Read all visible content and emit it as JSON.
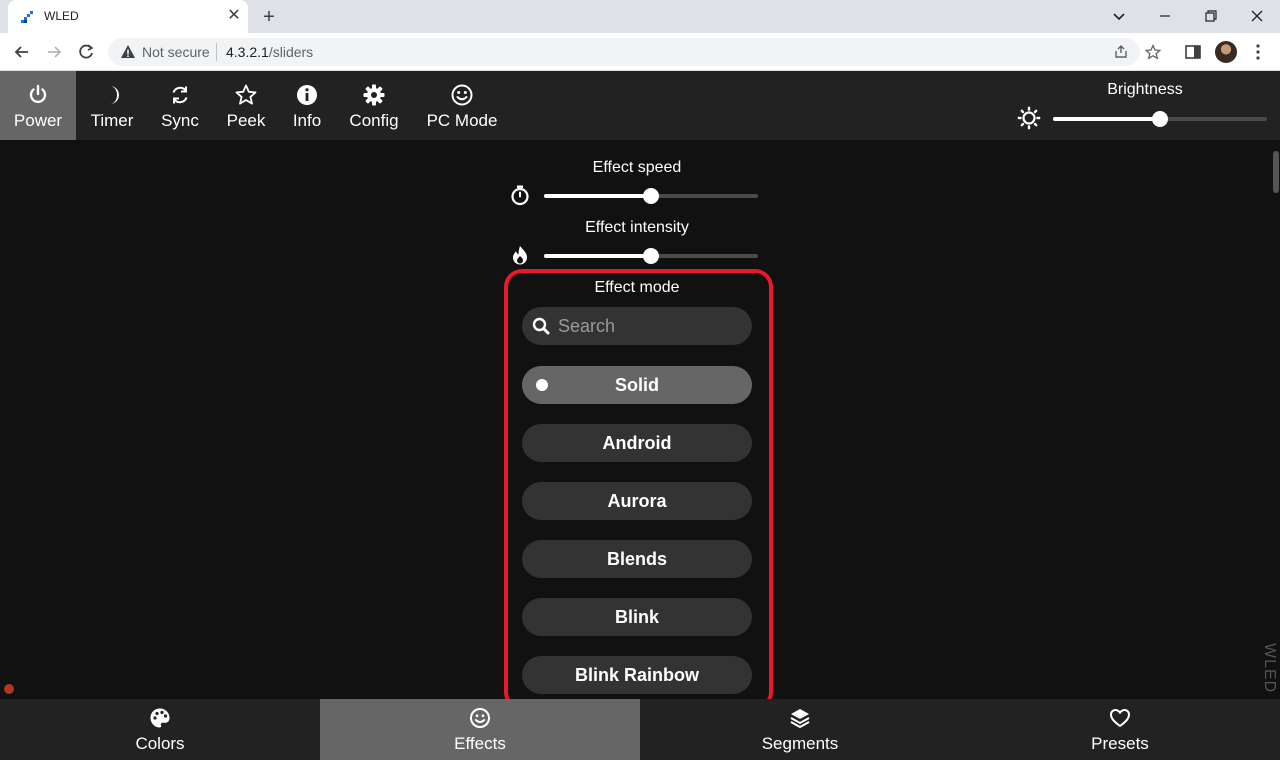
{
  "browser": {
    "tab_title": "WLED",
    "not_secure": "Not secure",
    "url_host": "4.3.2.1",
    "url_path": "/sliders"
  },
  "topbar": {
    "buttons": [
      {
        "label": "Power",
        "icon": "power-icon"
      },
      {
        "label": "Timer",
        "icon": "moon-icon"
      },
      {
        "label": "Sync",
        "icon": "sync-icon"
      },
      {
        "label": "Peek",
        "icon": "star-icon"
      },
      {
        "label": "Info",
        "icon": "info-icon"
      },
      {
        "label": "Config",
        "icon": "gear-icon"
      },
      {
        "label": "PC Mode",
        "icon": "smiley-icon"
      }
    ],
    "active": "Power",
    "brightness_label": "Brightness",
    "brightness_value": 0.5
  },
  "effects": {
    "speed_label": "Effect speed",
    "speed_value": 0.5,
    "intensity_label": "Effect intensity",
    "intensity_value": 0.5,
    "mode_label": "Effect mode",
    "search_placeholder": "Search",
    "list": [
      "Solid",
      "Android",
      "Aurora",
      "Blends",
      "Blink",
      "Blink Rainbow"
    ],
    "selected": "Solid"
  },
  "watermark": "WLED",
  "bottombar": {
    "tabs": [
      {
        "label": "Colors",
        "icon": "palette-icon"
      },
      {
        "label": "Effects",
        "icon": "smiley-icon"
      },
      {
        "label": "Segments",
        "icon": "layers-icon"
      },
      {
        "label": "Presets",
        "icon": "heart-icon"
      }
    ],
    "active": "Effects"
  },
  "colors": {
    "accent_highlight": "#e8192c",
    "bar_bg": "#222222",
    "active_bg": "#666666",
    "pill_bg": "#333333"
  }
}
